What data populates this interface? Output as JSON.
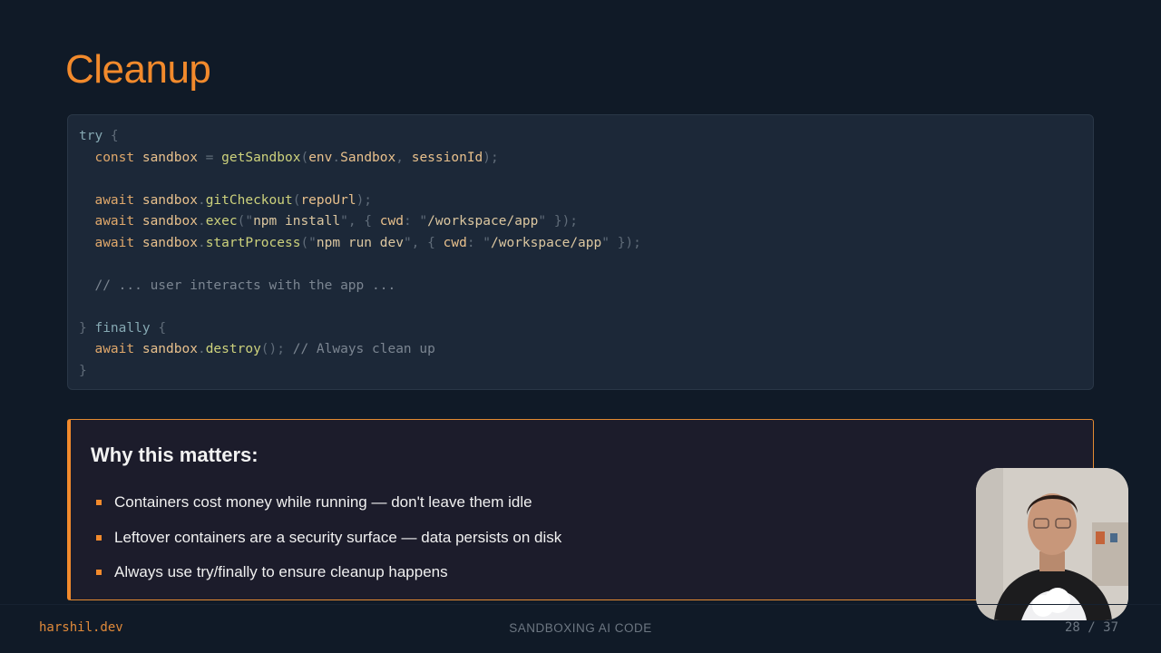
{
  "slide": {
    "title": "Cleanup",
    "code_lines": [
      [
        {
          "t": "try ",
          "c": "kw"
        },
        {
          "t": "{",
          "c": "pn"
        }
      ],
      [
        {
          "t": "  const ",
          "c": "kw2"
        },
        {
          "t": "sandbox",
          "c": "id"
        },
        {
          "t": " = ",
          "c": "pn"
        },
        {
          "t": "getSandbox",
          "c": "fn"
        },
        {
          "t": "(",
          "c": "pn"
        },
        {
          "t": "env",
          "c": "id"
        },
        {
          "t": ".",
          "c": "pn"
        },
        {
          "t": "Sandbox",
          "c": "id"
        },
        {
          "t": ", ",
          "c": "pn"
        },
        {
          "t": "sessionId",
          "c": "id"
        },
        {
          "t": ");",
          "c": "pn"
        }
      ],
      [],
      [
        {
          "t": "  await ",
          "c": "kw2"
        },
        {
          "t": "sandbox",
          "c": "id"
        },
        {
          "t": ".",
          "c": "pn"
        },
        {
          "t": "gitCheckout",
          "c": "fn"
        },
        {
          "t": "(",
          "c": "pn"
        },
        {
          "t": "repoUrl",
          "c": "id"
        },
        {
          "t": ");",
          "c": "pn"
        }
      ],
      [
        {
          "t": "  await ",
          "c": "kw2"
        },
        {
          "t": "sandbox",
          "c": "id"
        },
        {
          "t": ".",
          "c": "pn"
        },
        {
          "t": "exec",
          "c": "fn"
        },
        {
          "t": "(\"",
          "c": "pn"
        },
        {
          "t": "npm install",
          "c": "st"
        },
        {
          "t": "\", { ",
          "c": "pn"
        },
        {
          "t": "cwd",
          "c": "id"
        },
        {
          "t": ": \"",
          "c": "pn"
        },
        {
          "t": "/workspace/app",
          "c": "st"
        },
        {
          "t": "\" });",
          "c": "pn"
        }
      ],
      [
        {
          "t": "  await ",
          "c": "kw2"
        },
        {
          "t": "sandbox",
          "c": "id"
        },
        {
          "t": ".",
          "c": "pn"
        },
        {
          "t": "startProcess",
          "c": "fn"
        },
        {
          "t": "(\"",
          "c": "pn"
        },
        {
          "t": "npm run dev",
          "c": "st"
        },
        {
          "t": "\", { ",
          "c": "pn"
        },
        {
          "t": "cwd",
          "c": "id"
        },
        {
          "t": ": \"",
          "c": "pn"
        },
        {
          "t": "/workspace/app",
          "c": "st"
        },
        {
          "t": "\" });",
          "c": "pn"
        }
      ],
      [],
      [
        {
          "t": "  // ... user interacts with the app ...",
          "c": "cm"
        }
      ],
      [],
      [
        {
          "t": "} ",
          "c": "pn"
        },
        {
          "t": "finally ",
          "c": "kw"
        },
        {
          "t": "{",
          "c": "pn"
        }
      ],
      [
        {
          "t": "  await ",
          "c": "kw2"
        },
        {
          "t": "sandbox",
          "c": "id"
        },
        {
          "t": ".",
          "c": "pn"
        },
        {
          "t": "destroy",
          "c": "fn"
        },
        {
          "t": "(); ",
          "c": "pn"
        },
        {
          "t": "// Always clean up",
          "c": "cm"
        }
      ],
      [
        {
          "t": "}",
          "c": "pn"
        }
      ]
    ],
    "callout": {
      "heading": "Why this matters:",
      "bullets": [
        "Containers cost money while running — don't leave them idle",
        "Leftover containers are a security surface — data persists on disk",
        "Always use try/finally to ensure cleanup happens"
      ]
    }
  },
  "footer": {
    "site": "harshil.dev",
    "deck_title": "SANDBOXING AI CODE",
    "page_indicator": "28 / 37"
  },
  "colors": {
    "accent": "#f28a2c",
    "background": "#101a27",
    "code_background": "#1c2838",
    "callout_background": "#1c1c2b"
  }
}
